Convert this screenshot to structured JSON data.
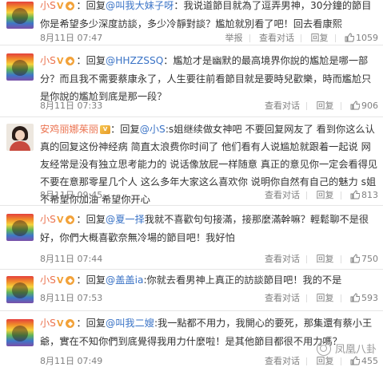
{
  "comments": [
    {
      "username": "小S",
      "prefix": "：回复",
      "mention": "@叫我大妹子呀",
      "text": "：我说道節目就為了逗弄男神，30分鐘的節目你是希望多少深度訪談，多少冷靜對談？尷尬就別看了吧！回去看康熙",
      "time": "8月11日 07:47",
      "actions": [
        "举报",
        "查看对话",
        "回复"
      ],
      "likes": "1059"
    },
    {
      "username": "小S",
      "prefix": "：回复",
      "mention": "@HHZZSSQ",
      "text": "：尷尬才是幽默的最高境界你說的尷尬是哪一部分？而且我不需要蔡康永了，人生要往前看節目就是要時兒歡樂，時而尷尬只是你說的尷尬到底是那一段？",
      "time": "8月11日 07:33",
      "actions": [
        "查看对话",
        "回复"
      ],
      "likes": "906"
    },
    {
      "username": "安鸡丽娜茱丽",
      "prefix": "：回复",
      "mention": "@小S",
      "text": ":s姐继续做女神吧 不要回复网友了 看到你这么认真的回复这份神经病 简直太浪费你时间了 他们看有人说尴尬就跟着一起说 网友经常是没有独立思考能力的 说话像放屁一样随意 真正的意见你一定会看得见 不要在意那零星几个人 这么多年大家这么喜欢你 说明你自然有自己的魅力 s姐 不希望你加油 希望你开心",
      "time": "8月11日 09:45",
      "actions": [
        "查看对话",
        "回复"
      ],
      "likes": "813"
    },
    {
      "username": "小S",
      "prefix": "：回复",
      "mention": "@夏一择",
      "text": "我就不喜歡句句接滿，接那麼滿幹嘛？輕鬆聊不是很好，你們大概喜歡奈無冷場的節目吧！我好怕",
      "time": "8月11日 07:44",
      "actions": [
        "查看对话",
        "回复"
      ],
      "likes": "750"
    },
    {
      "username": "小S",
      "prefix": "：回复",
      "mention": "@盖盖ia",
      "text": ":你就去看男神上真正的訪談節目吧！我的不是",
      "time": "8月11日 07:53",
      "actions": [
        "查看对话",
        "回复"
      ],
      "likes": "593"
    },
    {
      "username": "小S",
      "prefix": "：回复",
      "mention": "@叫我二嫂",
      "text": ":我一點都不用力，我開心的要死，那集還有蔡小王爺，實在不知你們到底覺得我用力什麼啦！是其他節目都很不用力嗎？",
      "time": "8月11日 07:49",
      "actions": [
        "查看对话",
        "回复"
      ],
      "likes": "455"
    }
  ],
  "watermark": "凤凰八卦",
  "colors": {
    "username": "#eb7350",
    "mention": "#3a73c6",
    "meta": "#808080"
  }
}
